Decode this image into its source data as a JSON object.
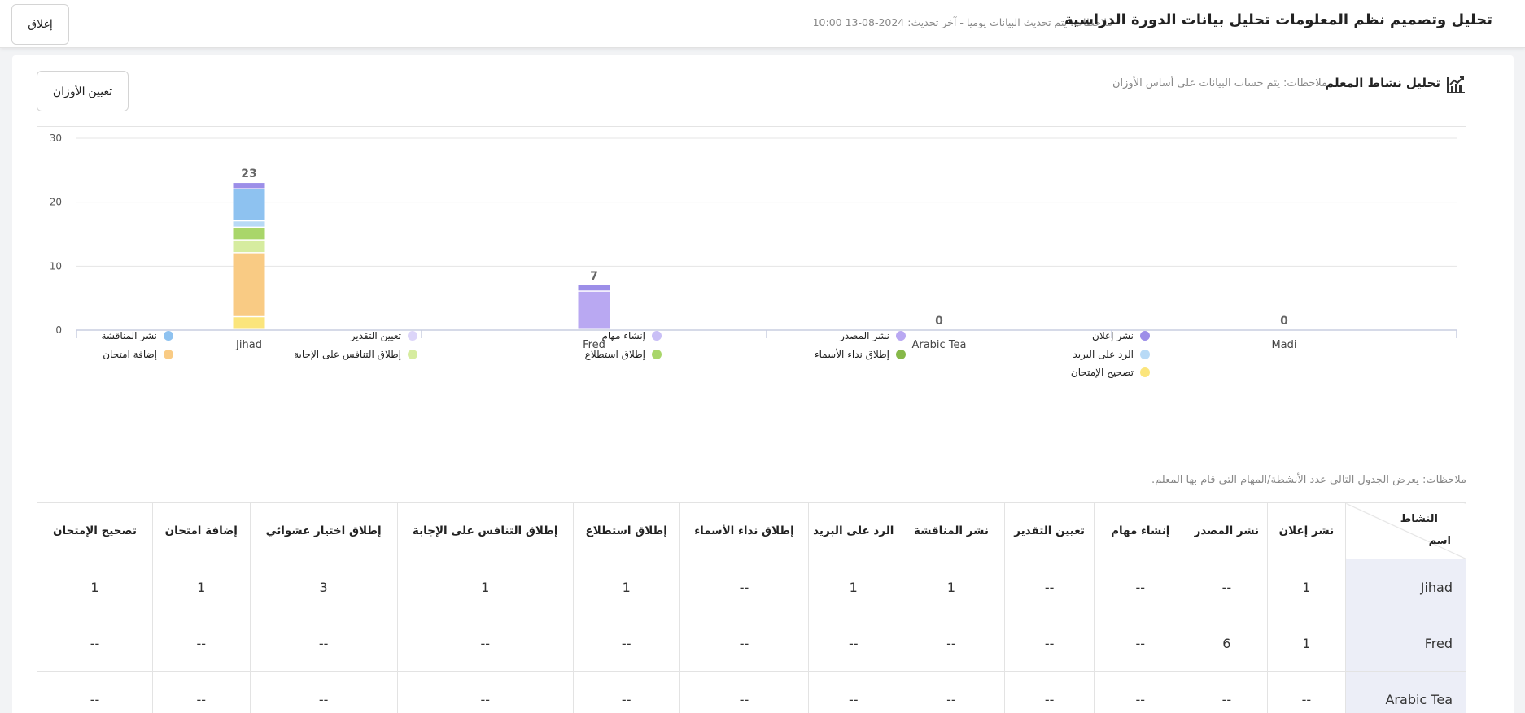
{
  "header": {
    "title": "تحليل وتصميم نظم المعلومات تحليل بيانات الدورة الدراسية",
    "note": "ملاحظات: يتم تحديث البيانات يوميا - آخر تحديث: 2024-08-13 10:00",
    "close_label": "إغلاق"
  },
  "section": {
    "title": "تحليل نشاط المعلم",
    "note": "ملاحظات: يتم حساب البيانات على أساس الأوزان",
    "weights_label": "تعيين الأوزان",
    "icon": "trend-chart-icon"
  },
  "chart_data": {
    "type": "bar",
    "stacked": true,
    "categories": [
      "Jihad",
      "Fred",
      "Arabic Tea",
      "Madi"
    ],
    "totals": [
      23,
      7,
      0,
      0
    ],
    "ylim": [
      0,
      30
    ],
    "yticks": [
      0,
      10,
      20,
      30
    ],
    "grid": true,
    "legend_position": "bottom",
    "series": [
      {
        "name": "تصحيح الإمتحان",
        "color": "#fbe57c",
        "values": [
          2,
          0,
          0,
          0
        ]
      },
      {
        "name": "إضافة امتحان",
        "color": "#f9cb84",
        "values": [
          10,
          0,
          0,
          0
        ]
      },
      {
        "name": "إطلاق التنافس على الإجابة",
        "color": "#d6ec9f",
        "values": [
          2,
          0,
          0,
          0
        ]
      },
      {
        "name": "إطلاق استطلاع",
        "color": "#a9d66a",
        "values": [
          2,
          0,
          0,
          0
        ]
      },
      {
        "name": "الرد على البريد",
        "color": "#b8daf6",
        "values": [
          1,
          0,
          0,
          0
        ]
      },
      {
        "name": "نشر المناقشة",
        "color": "#8ec2f0",
        "values": [
          5,
          0,
          0,
          0
        ]
      },
      {
        "name": "نشر المصدر",
        "color": "#b9a8f2",
        "values": [
          0,
          6,
          0,
          0
        ]
      },
      {
        "name": "نشر إعلان",
        "color": "#9c8ee8",
        "values": [
          1,
          1,
          0,
          0
        ]
      }
    ]
  },
  "legend": [
    {
      "label": "نشر إعلان",
      "color": "#9c8ee8"
    },
    {
      "label": "نشر المصدر",
      "color": "#b9a8f2"
    },
    {
      "label": "إنشاء مهام",
      "color": "#c9bff6"
    },
    {
      "label": "تعيين التقدير",
      "color": "#dcd5f9"
    },
    {
      "label": "نشر المناقشة",
      "color": "#8ec2f0"
    },
    {
      "label": "الرد على البريد",
      "color": "#b8daf6"
    },
    {
      "label": "إطلاق نداء الأسماء",
      "color": "#86b849"
    },
    {
      "label": "إطلاق استطلاع",
      "color": "#a9d66a"
    },
    {
      "label": "إطلاق التنافس على الإجابة",
      "color": "#d6ec9f"
    },
    {
      "label": "إضافة امتحان",
      "color": "#f9cb84"
    },
    {
      "label": "تصحيح الإمتحان",
      "color": "#fbe57c"
    }
  ],
  "table": {
    "note": "ملاحظات: يعرض الجدول التالي عدد الأنشطة/المهام التي قام بها المعلم.",
    "corner_top": "النشاط",
    "corner_bottom": "اسم",
    "columns": [
      "نشر إعلان",
      "نشر المصدر",
      "إنشاء مهام",
      "تعيين التقدير",
      "نشر المناقشة",
      "الرد على البريد",
      "إطلاق نداء الأسماء",
      "إطلاق استطلاع",
      "إطلاق التنافس على الإجابة",
      "إطلاق اختيار عشوائي",
      "إضافة امتحان",
      "تصحيح الإمتحان"
    ],
    "rows": [
      {
        "name": "Jihad",
        "cells": [
          "1",
          "--",
          "--",
          "--",
          "1",
          "1",
          "--",
          "1",
          "1",
          "3",
          "1",
          "1"
        ]
      },
      {
        "name": "Fred",
        "cells": [
          "1",
          "6",
          "--",
          "--",
          "--",
          "--",
          "--",
          "--",
          "--",
          "--",
          "--",
          "--"
        ]
      },
      {
        "name": "Arabic Tea",
        "cells": [
          "--",
          "--",
          "--",
          "--",
          "--",
          "--",
          "--",
          "--",
          "--",
          "--",
          "--",
          "--"
        ]
      }
    ]
  }
}
